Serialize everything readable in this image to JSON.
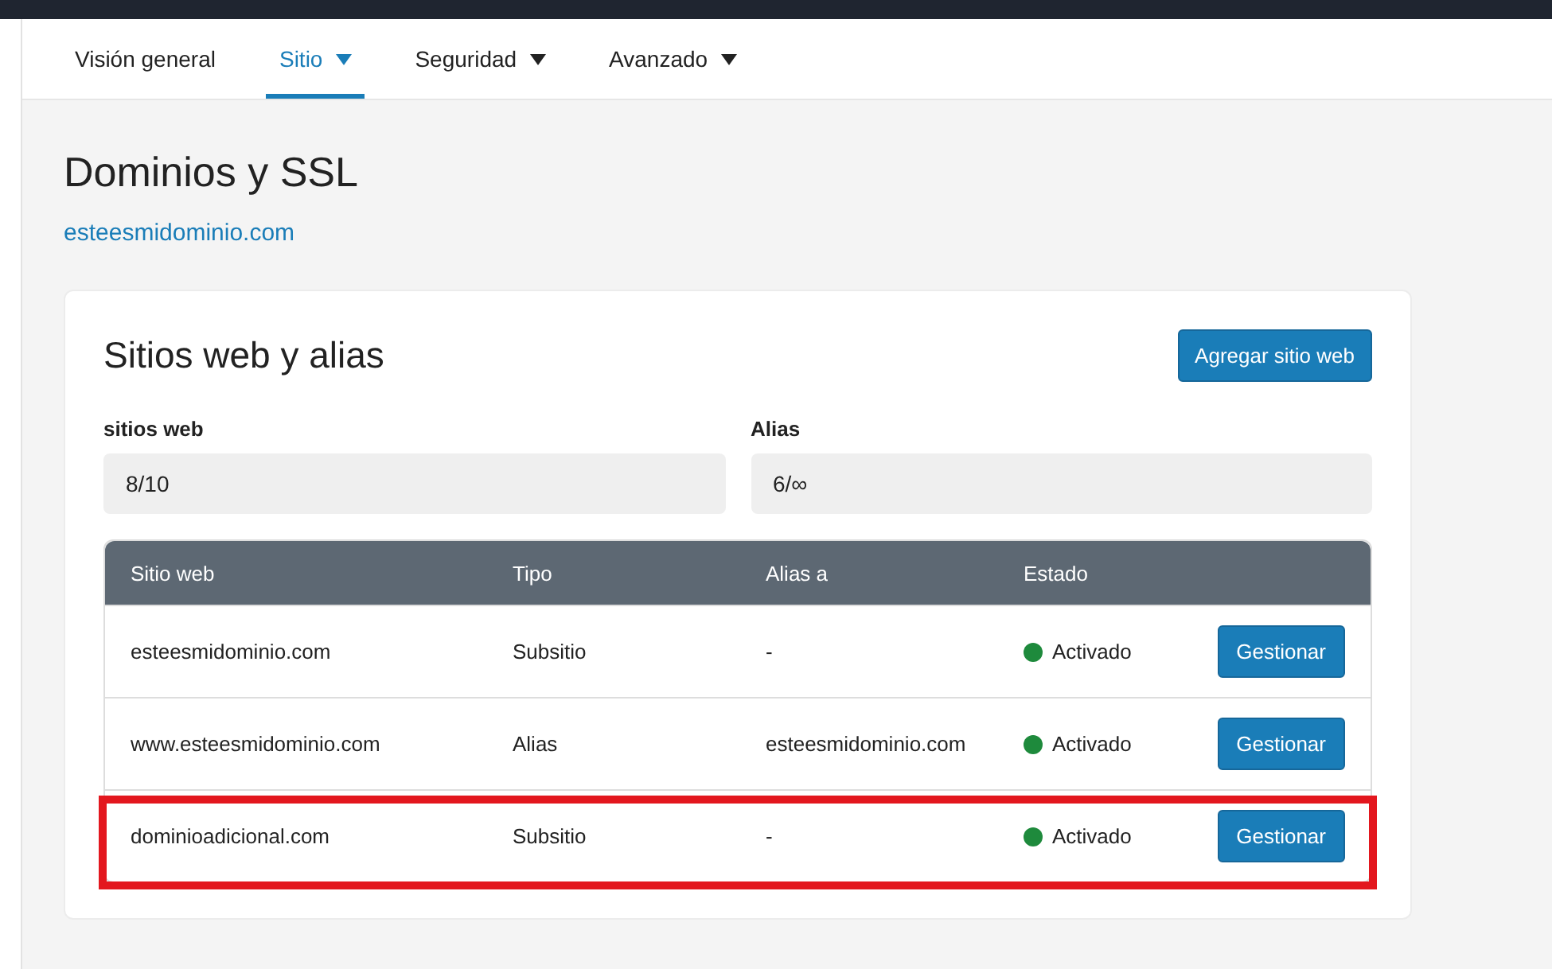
{
  "tabs": [
    {
      "label": "Visión general",
      "dropdown": false,
      "selected": false
    },
    {
      "label": "Sitio",
      "dropdown": true,
      "selected": true
    },
    {
      "label": "Seguridad",
      "dropdown": true,
      "selected": false
    },
    {
      "label": "Avanzado",
      "dropdown": true,
      "selected": false
    }
  ],
  "page": {
    "title": "Dominios y SSL",
    "domain_link": "esteesmidominio.com"
  },
  "card": {
    "title": "Sitios web y alias",
    "add_button": "Agregar sitio web",
    "stats": [
      {
        "label": "sitios web",
        "value": "8/10"
      },
      {
        "label": "Alias",
        "value": "6/∞"
      }
    ],
    "table": {
      "columns": [
        "Sitio web",
        "Tipo",
        "Alias a",
        "Estado"
      ],
      "rows": [
        {
          "site": "esteesmidominio.com",
          "type": "Subsitio",
          "alias_of": "-",
          "status": "Activado",
          "action": "Gestionar",
          "highlighted": false
        },
        {
          "site": "www.esteesmidominio.com",
          "type": "Alias",
          "alias_of": "esteesmidominio.com",
          "status": "Activado",
          "action": "Gestionar",
          "highlighted": false
        },
        {
          "site": "dominioadicional.com",
          "type": "Subsitio",
          "alias_of": "-",
          "status": "Activado",
          "action": "Gestionar",
          "highlighted": true
        }
      ]
    }
  }
}
